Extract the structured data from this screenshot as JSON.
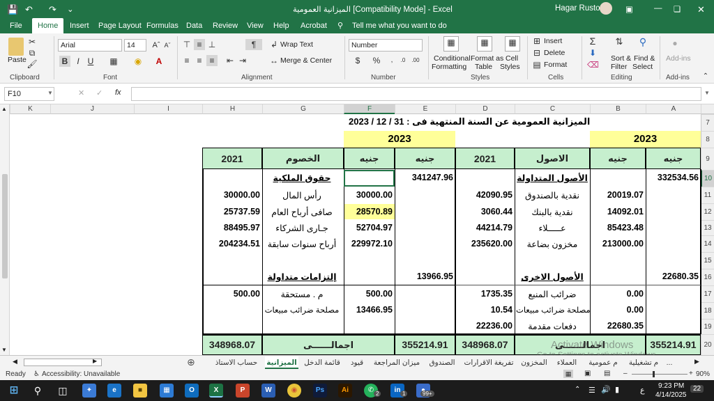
{
  "titlebar": {
    "title": "الميزانية العمومية  [Compatibility Mode]  -  Excel",
    "user": "Hagar Rustom"
  },
  "menu": [
    "File",
    "Home",
    "Insert",
    "Page Layout",
    "Formulas",
    "Data",
    "Review",
    "View",
    "Help",
    "Acrobat"
  ],
  "tell_me": "Tell me what you want to do",
  "ribbon": {
    "paste": "Paste",
    "font_name": "Arial",
    "font_size": "14",
    "wrap_text": "Wrap Text",
    "merge_center": "Merge & Center",
    "number_format": "Number",
    "conditional": "Conditional",
    "formatting": "Formatting",
    "format_as": "Format as",
    "table": "Table",
    "cell": "Cell",
    "styles_lbl": "Styles",
    "insert": "Insert",
    "delete": "Delete",
    "format": "Format",
    "sort": "Sort &",
    "filter": "Filter",
    "find": "Find &",
    "select": "Select",
    "addins": "Add-ins",
    "groups": {
      "clipboard": "Clipboard",
      "font": "Font",
      "alignment": "Alignment",
      "number": "Number",
      "styles": "Styles",
      "cells": "Cells",
      "editing": "Editing",
      "addins": "Add-ins"
    }
  },
  "formula": {
    "name_box": "F10",
    "fx": "fx"
  },
  "columns": [
    "K",
    "J",
    "I",
    "H",
    "G",
    "F",
    "E",
    "D",
    "C",
    "B",
    "A"
  ],
  "rows": [
    "7",
    "8",
    "9",
    "10",
    "11",
    "12",
    "13",
    "14",
    "15",
    "16",
    "17",
    "18",
    "19",
    "20"
  ],
  "sheet": {
    "title": "الميزانية العمومية عن السنة المنتهية فى :  31 / 12 / 2023",
    "year_left": "2023",
    "year_right": "2023",
    "headers": {
      "h_2021": "2021",
      "g_khosoom": "الخصوم",
      "f_geneh": "جنيه",
      "e_geneh": "جنيه",
      "d_2021": "2021",
      "c_osool": "الاصول",
      "b_geneh": "جنيه",
      "a_geneh": "جنيه"
    },
    "r10": {
      "g": "حقوق الملكية",
      "e": "341247.96",
      "c": "الأصول المتداولة",
      "a": "332534.56"
    },
    "r11": {
      "h": "30000.00",
      "g": "رأس المال",
      "f": "30000.00",
      "d": "42090.95",
      "c": "نقدية بالصندوق",
      "b": "20019.07"
    },
    "r12": {
      "h": "25737.59",
      "g": "صافى أرباح العام",
      "f": "28570.89",
      "d": "3060.44",
      "c": "نقدية بالبنك",
      "b": "14092.01"
    },
    "r13": {
      "h": "88495.97",
      "g": "جـارى الشركاء",
      "f": "52704.97",
      "d": "44214.79",
      "c": "عـــــلاء",
      "b": "85423.48"
    },
    "r14": {
      "h": "204234.51",
      "g": "أرباح سنوات سابقة",
      "f": "229972.10",
      "d": "235620.00",
      "c": "مخزون بضاعة",
      "b": "213000.00"
    },
    "r16": {
      "g": "إلتزامات متداولة",
      "e": "13966.95",
      "c": "الأصول الاخرى",
      "a": "22680.35"
    },
    "r17": {
      "h": "500.00",
      "g": "م . مستحقة",
      "f": "500.00",
      "d": "1735.35",
      "c": "ضرائب المنبع",
      "b": "0.00"
    },
    "r18": {
      "g": "مصلحة ضرائب مبيعات",
      "f": "13466.95",
      "d": "10.54",
      "c": "مصلحة ضرائب مبيعات",
      "b": "0.00"
    },
    "r19": {
      "d": "22236.00",
      "c": "دفعات مقدمة",
      "b": "22680.35"
    },
    "r20": {
      "h": "348968.07",
      "g": "اجمالــــــى",
      "e": "355214.91",
      "d": "348968.07",
      "c": "اجمالــــــى",
      "a": "355214.91"
    }
  },
  "watermark": {
    "line1": "Activate Windows",
    "line2": "Go to Settings to activate Windows."
  },
  "tabs": [
    "حساب الاستاذ",
    "الميزانية",
    "قائمة الدخل",
    "قيود",
    "ميزان المراجعة",
    "الصندوق",
    "تفريغة الاقرارات",
    "المخزون",
    "العملاء",
    "م عمومية",
    "م تشغيلية",
    "..."
  ],
  "status": {
    "ready": "Ready",
    "accessibility": "Accessibility: Unavailable",
    "zoom": "90%"
  },
  "taskbar": {
    "time": "9:23 PM",
    "date": "4/14/2025",
    "lang": "ع",
    "notif": "22",
    "badge_whatsapp": "2",
    "badge_linkedin": "1",
    "badge_other": "99+"
  },
  "colors": {
    "excel_green": "#217346",
    "header_fill": "#c6efce",
    "year_fill": "#ffff99",
    "selected_fill": "#ffff99"
  }
}
